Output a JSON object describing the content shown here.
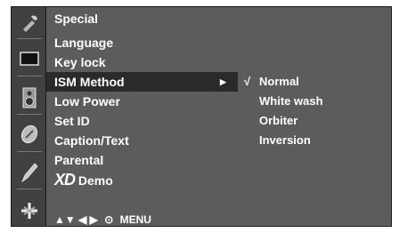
{
  "menu": {
    "title": "Special",
    "items": [
      {
        "label": "Language",
        "selected": false
      },
      {
        "label": "Key lock",
        "selected": false
      },
      {
        "label": "ISM Method",
        "selected": true,
        "has_submenu": true
      },
      {
        "label": "Low Power",
        "selected": false
      },
      {
        "label": "Set ID",
        "selected": false
      },
      {
        "label": "Caption/Text",
        "selected": false
      },
      {
        "label": "Parental",
        "selected": false
      },
      {
        "label_logo": "XD",
        "label": "Demo",
        "selected": false
      }
    ],
    "nav_hint": {
      "arrows": "▲▼ ◀ ▶",
      "ok_symbol": "⊙",
      "menu_label": "MENU"
    }
  },
  "submenu": {
    "items": [
      {
        "label": "Normal",
        "checked": true
      },
      {
        "label": "White wash",
        "checked": false
      },
      {
        "label": "Orbiter",
        "checked": false
      },
      {
        "label": "Inversion",
        "checked": false
      }
    ],
    "check_mark": "√"
  },
  "icons": [
    "special-tools-icon",
    "screen-icon",
    "audio-speaker-icon",
    "time-clock-icon",
    "option-pen-icon",
    "input-plug-icon"
  ],
  "colors": {
    "panel_bg": "#5c5c5c",
    "icon_column_bg": "#414141",
    "selected_bg": "#2a2a2a",
    "text": "#ffffff"
  }
}
